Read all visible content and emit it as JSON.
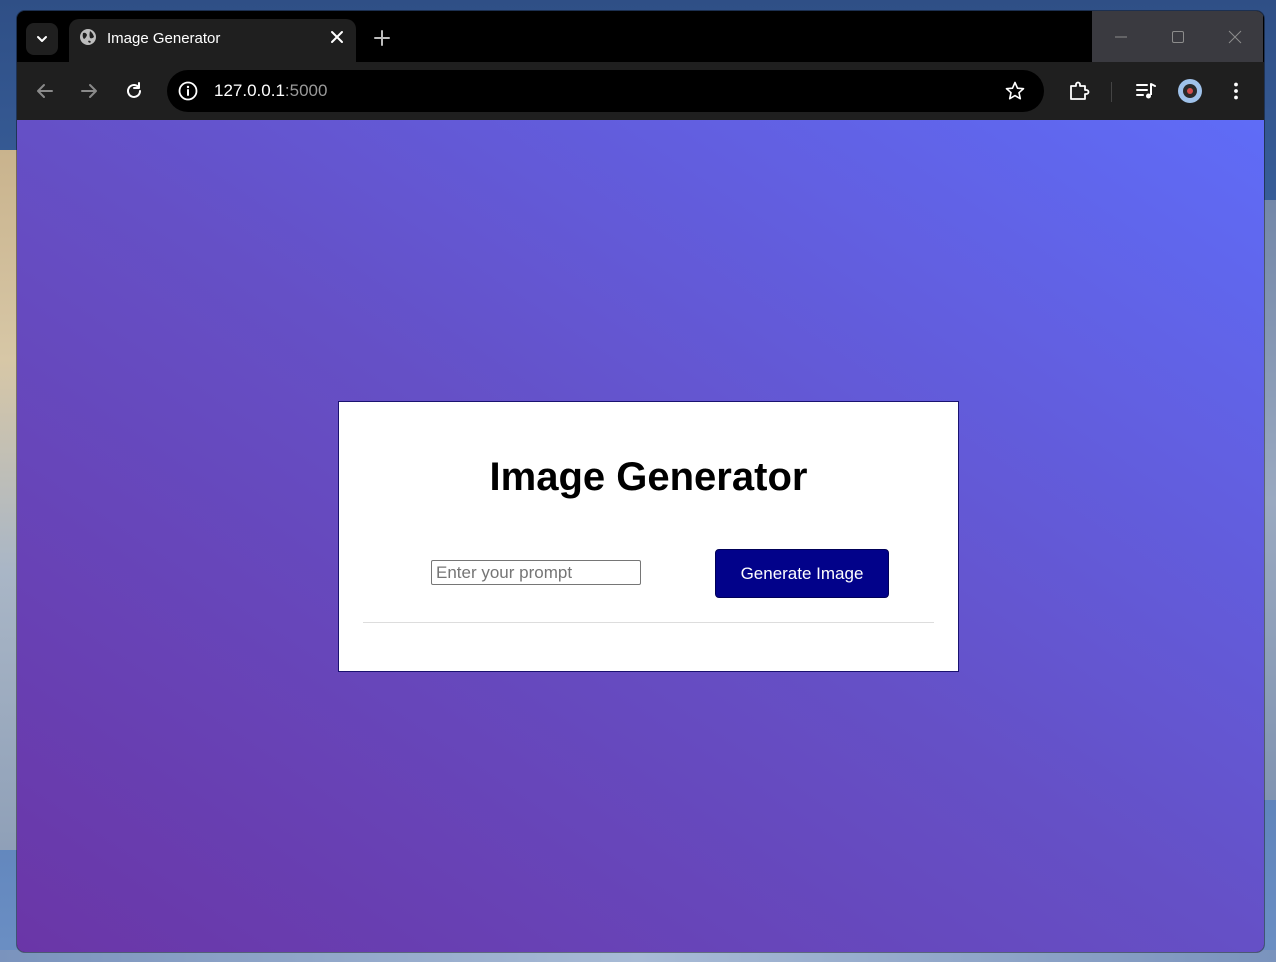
{
  "browser": {
    "tab": {
      "title": "Image Generator",
      "favicon_icon": "globe-icon"
    },
    "address_bar": {
      "host": "127.0.0.1",
      "port": ":5000"
    },
    "icons": {
      "tab_search": "chevron-down-icon",
      "tab_close": "close-icon",
      "new_tab": "plus-icon",
      "back": "arrow-left-icon",
      "forward": "arrow-right-icon",
      "reload": "reload-icon",
      "site_info": "info-icon",
      "bookmark": "star-icon",
      "extensions": "puzzle-icon",
      "media": "media-queue-icon",
      "profile": "avatar",
      "menu": "kebab-menu-icon",
      "minimize": "minimize-icon",
      "maximize": "maximize-icon",
      "window_close": "window-close-icon"
    }
  },
  "page": {
    "heading": "Image Generator",
    "prompt": {
      "placeholder": "Enter your prompt",
      "value": ""
    },
    "generate_button": "Generate Image"
  },
  "colors": {
    "bg_gradient_start": "#6a36a7",
    "bg_gradient_end": "#5f6cf7",
    "button_bg": "#02028a",
    "card_bg": "#ffffff"
  }
}
